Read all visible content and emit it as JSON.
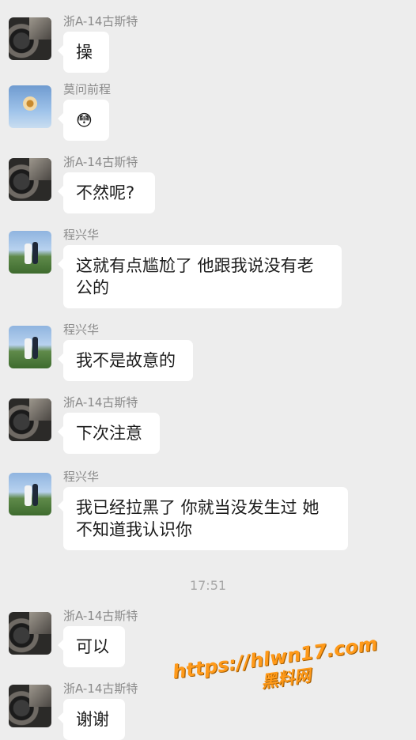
{
  "messages": [
    {
      "sender": "浙A-14古斯特",
      "lines": [
        "操"
      ]
    },
    {
      "sender": "莫问前程",
      "lines": [
        "😳"
      ]
    },
    {
      "sender": "浙A-14古斯特",
      "lines": [
        "不然呢?"
      ]
    },
    {
      "sender": "程兴华",
      "lines": [
        "这就有点尴尬了 他跟我说没有老",
        "公的"
      ]
    },
    {
      "sender": "程兴华",
      "lines": [
        "我不是故意的"
      ]
    },
    {
      "sender": "浙A-14古斯特",
      "lines": [
        "下次注意"
      ]
    },
    {
      "sender": "程兴华",
      "lines": [
        "我已经拉黑了 你就当没发生过 她",
        "不知道我认识你"
      ]
    },
    {
      "sender": "浙A-14古斯特",
      "lines": [
        "可以"
      ]
    },
    {
      "sender": "浙A-14古斯特",
      "lines": [
        "谢谢"
      ]
    }
  ],
  "timestamp": "17:51",
  "watermark": {
    "url": "https://hlwn17.com",
    "name": "黑料网"
  },
  "colors": {
    "background": "#ededed",
    "bubble": "#ffffff",
    "watermark": "#ff9a1a"
  }
}
